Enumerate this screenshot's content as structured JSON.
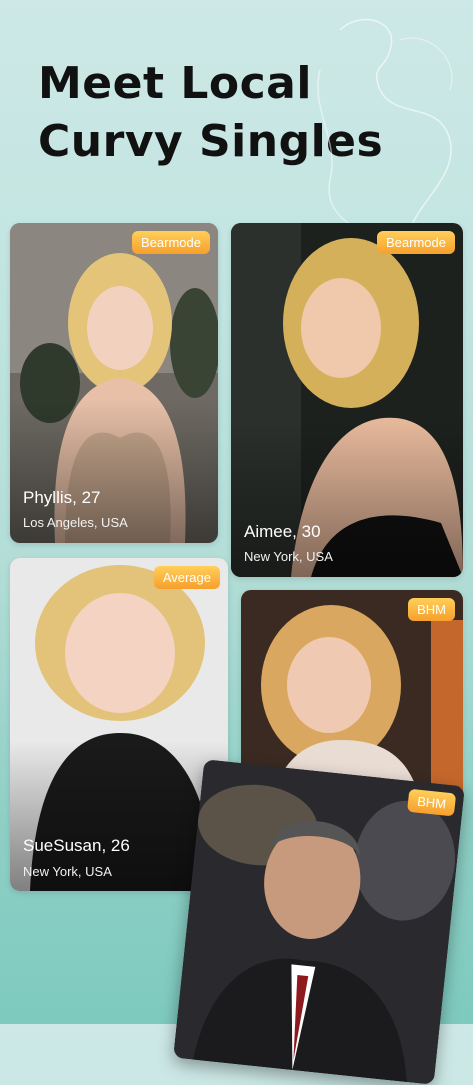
{
  "headline": "Meet Local\nCurvy Singles",
  "cards": [
    {
      "name_age": "Phyllis, 27",
      "location": "Los Angeles, USA",
      "badge": "Bearmode"
    },
    {
      "name_age": "Aimee, 30",
      "location": "New York, USA",
      "badge": "Bearmode"
    },
    {
      "name_age": "SueSusan, 26",
      "location": "New York, USA",
      "badge": "Average"
    },
    {
      "badge": "BHM"
    },
    {
      "badge": "BHM"
    }
  ]
}
